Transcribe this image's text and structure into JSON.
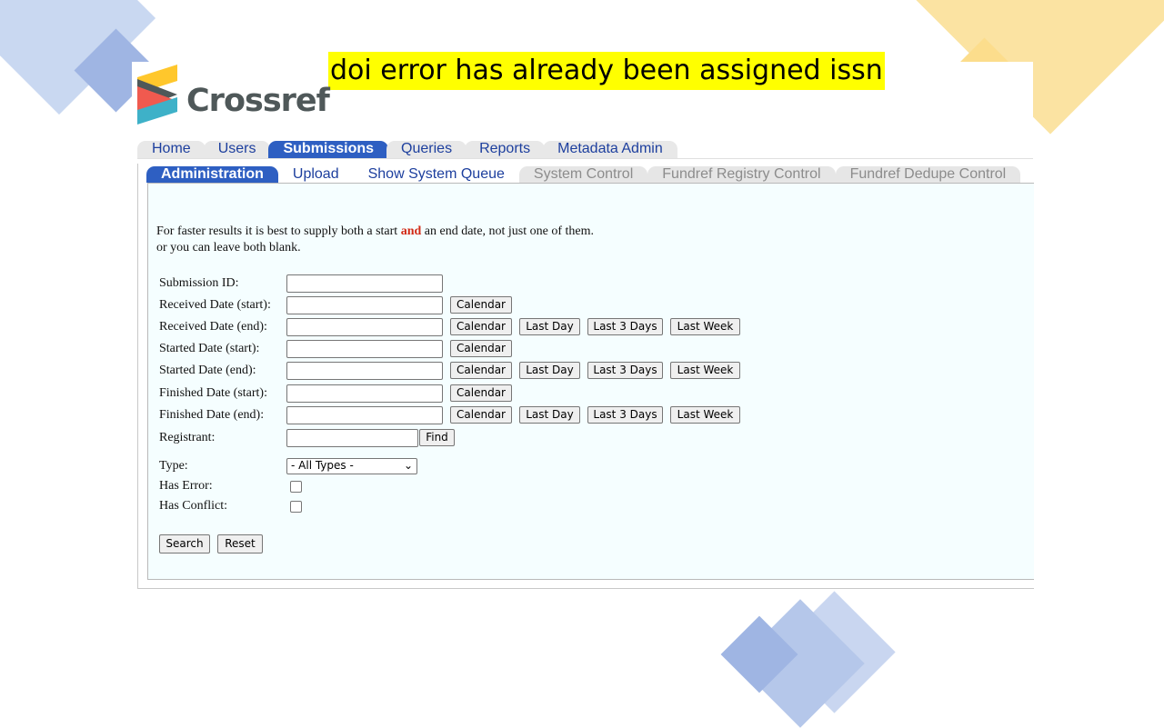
{
  "overlay_title": "doi error has already been assigned issn",
  "logo": {
    "text": "Crossref",
    "colors": [
      "#f05a4f",
      "#3eb1c8",
      "#ffc72c",
      "#4f5859"
    ]
  },
  "top_nav": [
    {
      "label": "Home",
      "active": false
    },
    {
      "label": "Users",
      "active": false
    },
    {
      "label": "Submissions",
      "active": true
    },
    {
      "label": "Queries",
      "active": false
    },
    {
      "label": "Reports",
      "active": false
    },
    {
      "label": "Metadata Admin",
      "active": false
    }
  ],
  "sub_nav": [
    {
      "label": "Administration",
      "state": "active"
    },
    {
      "label": "Upload",
      "state": "normal"
    },
    {
      "label": "Show System Queue",
      "state": "normal"
    },
    {
      "label": "System Control",
      "state": "disabled"
    },
    {
      "label": "Fundref Registry Control",
      "state": "disabled"
    },
    {
      "label": "Fundref Dedupe Control",
      "state": "disabled"
    }
  ],
  "intro": {
    "line1_before": "For faster results it is best to supply both a start ",
    "line1_highlight": "and",
    "line1_after": " an end date, not just one of them.",
    "line2": "or you can leave both blank."
  },
  "form": {
    "submission_id_label": "Submission ID:",
    "received_start_label": "Received Date (start):",
    "received_end_label": "Received Date (end):",
    "started_start_label": "Started Date (start):",
    "started_end_label": "Started Date (end):",
    "finished_start_label": "Finished Date (start):",
    "finished_end_label": "Finished Date (end):",
    "registrant_label": "Registrant:",
    "type_label": "Type:",
    "type_value": "- All Types -",
    "has_error_label": "Has Error:",
    "has_conflict_label": "Has Conflict:"
  },
  "buttons": {
    "calendar": "Calendar",
    "last_day": "Last Day",
    "last_3_days": "Last 3 Days",
    "last_week": "Last Week",
    "find": "Find",
    "search": "Search",
    "reset": "Reset"
  },
  "colors": {
    "accent": "#2e5fc2",
    "highlight": "#ffff00",
    "panel_bg": "#f5feff",
    "and_red": "#d22a16"
  }
}
